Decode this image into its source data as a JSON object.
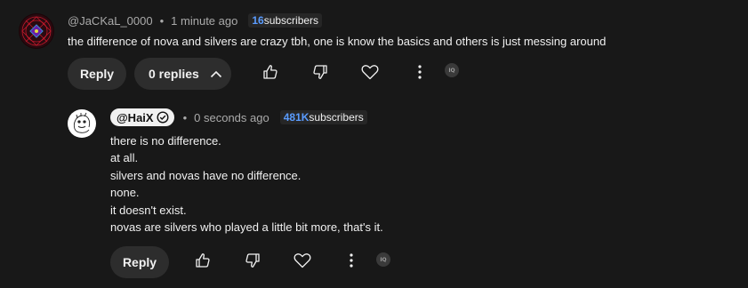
{
  "comment": {
    "handle": "@JaCKaL_0000",
    "separator": "•",
    "time": "1 minute ago",
    "subscribers_count": "16",
    "subscribers_label": "subscribers",
    "text": "the difference of nova and silvers are crazy tbh, one is know the basics and others is just messing around",
    "reply_label": "Reply",
    "replies_label": "0 replies",
    "ext_badge": "IQ"
  },
  "reply": {
    "handle": "@HaiX",
    "separator": "•",
    "time": "0 seconds ago",
    "subscribers_count": "481K",
    "subscribers_label": "subscribers",
    "lines": [
      "there is no difference.",
      "at all.",
      "silvers and novas have no difference.",
      "none.",
      "it doesn't exist.",
      "novas are silvers who played a little bit more, that's it."
    ],
    "reply_label": "Reply",
    "ext_badge": "IQ"
  },
  "icons": {
    "like": "thumbs-up-icon",
    "dislike": "thumbs-down-icon",
    "heart": "heart-icon",
    "more": "more-vert-icon",
    "chevron": "chevron-up-icon",
    "verified": "verified-check-icon"
  },
  "colors": {
    "background": "#181818",
    "button": "#2d2d2d",
    "subscriber_count": "#5a9cff",
    "text": "#f1f1f1",
    "muted": "#aaaaaa"
  }
}
